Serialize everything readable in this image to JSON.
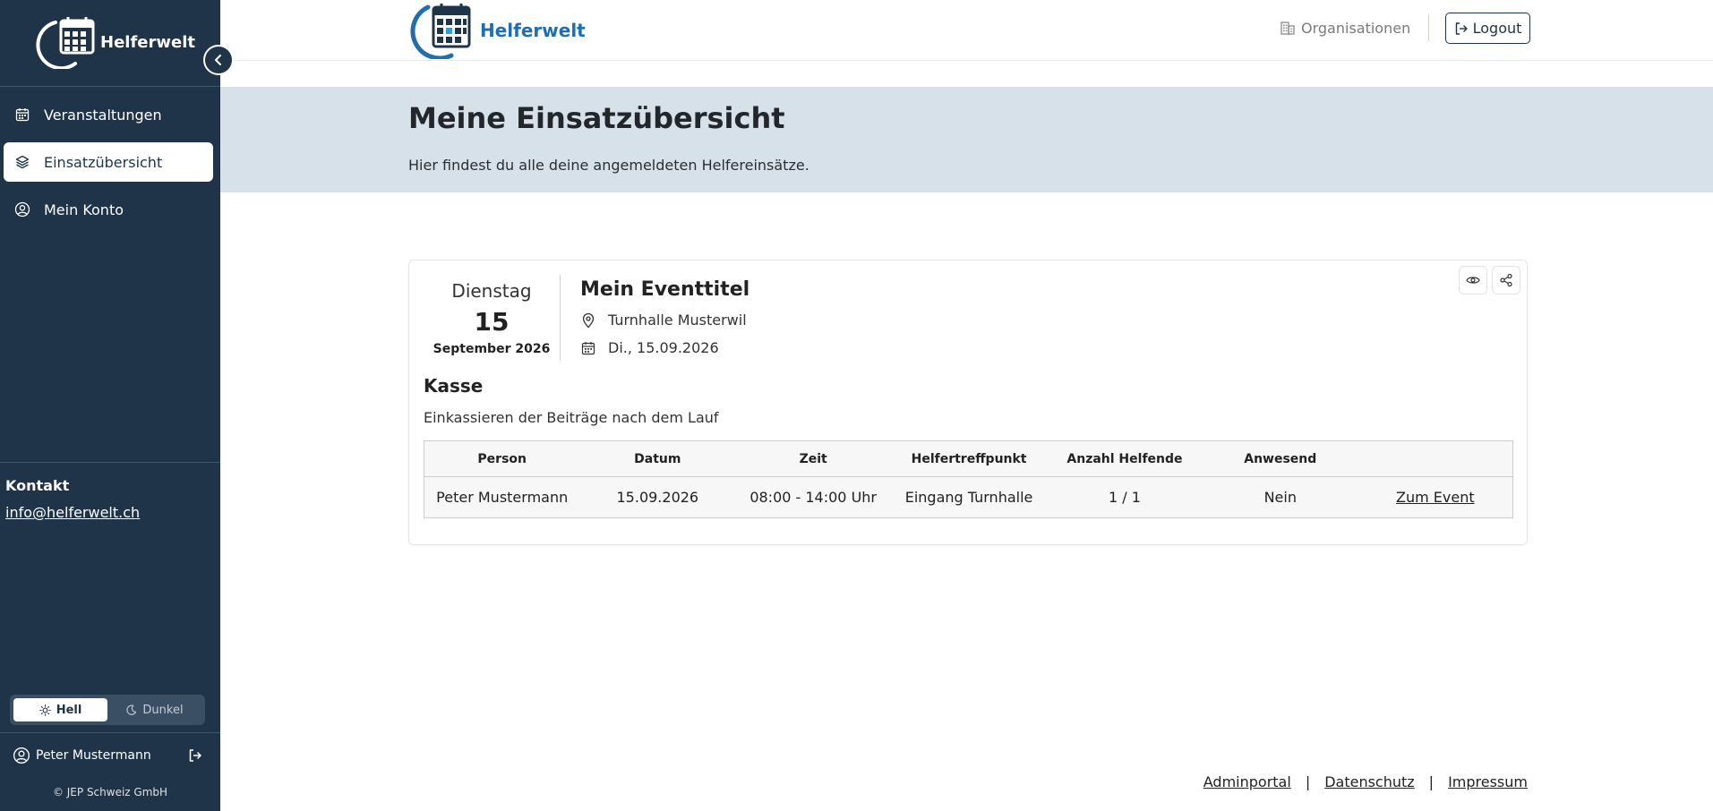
{
  "app": {
    "brand": "Helferwelt"
  },
  "sidebar": {
    "brand": "Helferwelt",
    "items": [
      {
        "label": "Veranstaltungen",
        "icon": "calendar-icon"
      },
      {
        "label": "Einsatzübersicht",
        "icon": "layers-icon",
        "active": true
      },
      {
        "label": "Mein Konto",
        "icon": "user-circle-icon"
      }
    ],
    "contact_title": "Kontakt",
    "contact_email": "info@helferwelt.ch",
    "theme": {
      "light_label": "Hell",
      "dark_label": "Dunkel",
      "selected": "Hell"
    },
    "user_name": "Peter Mustermann",
    "copyright": "© JEP Schweiz GmbH"
  },
  "header": {
    "brand": "Helferwelt",
    "organisations_label": "Organisationen",
    "logout_label": "Logout"
  },
  "hero": {
    "title": "Meine Einsatzübersicht",
    "subtitle": "Hier findest du alle deine angemeldeten Helfereinsätze."
  },
  "event": {
    "weekday": "Dienstag",
    "day": "15",
    "month_year": "September 2026",
    "title": "Mein Eventtitel",
    "location": "Turnhalle Musterwil",
    "date": "Di., 15.09.2026",
    "shift_title": "Kasse",
    "shift_description": "Einkassieren der Beiträge nach dem Lauf",
    "table": {
      "headers": [
        "Person",
        "Datum",
        "Zeit",
        "Helfertreffpunkt",
        "Anzahl Helfende",
        "Anwesend",
        ""
      ],
      "rows": [
        {
          "person": "Peter Mustermann",
          "datum": "15.09.2026",
          "zeit": "08:00 - 14:00 Uhr",
          "treffpunkt": "Eingang Turnhalle",
          "anzahl": "1 / 1",
          "anwesend": "Nein",
          "link_label": "Zum Event"
        }
      ]
    }
  },
  "footer": {
    "links": [
      "Adminportal",
      "Datenschutz",
      "Impressum"
    ],
    "separator": "|"
  },
  "colors": {
    "sidebar_bg": "#1f3449",
    "hero_bg": "#d6e1ea",
    "brand_blue": "#1f6fb0"
  }
}
